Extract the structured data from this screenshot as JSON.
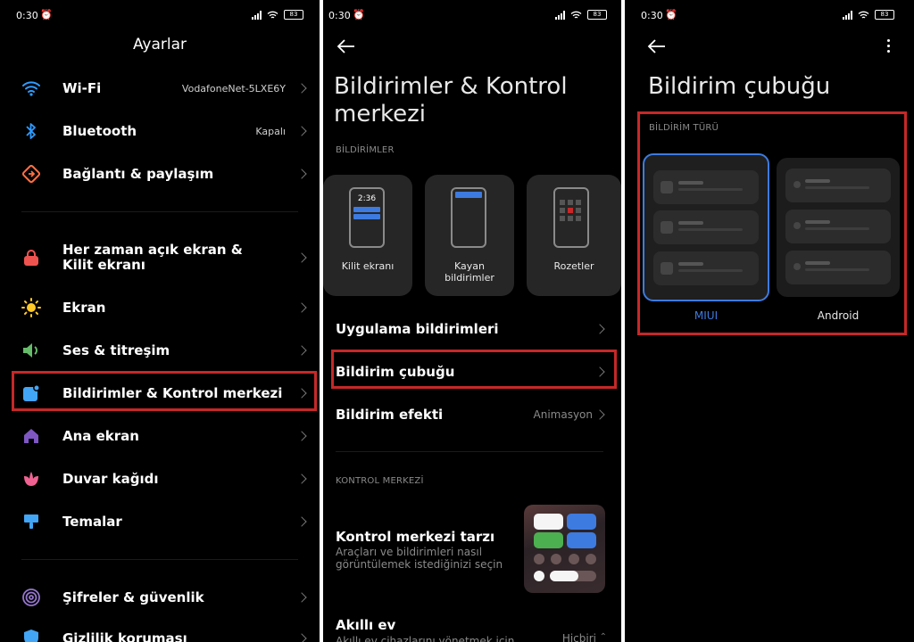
{
  "status": {
    "time": "0:30",
    "battery": "83"
  },
  "panel1": {
    "title": "Ayarlar",
    "items": [
      {
        "label": "Wi-Fi",
        "value": "VodafoneNet-5LXE6Y",
        "icon": "wifi-icon",
        "color": "#2f9bff"
      },
      {
        "label": "Bluetooth",
        "value": "Kapalı",
        "icon": "bluetooth-icon",
        "color": "#2f9bff"
      },
      {
        "label": "Bağlantı & paylaşım",
        "value": "",
        "icon": "connection-share-icon",
        "color": "#ff7043"
      },
      {
        "label": "Her zaman açık ekran & Kilit ekranı",
        "value": "",
        "icon": "lock-icon",
        "color": "#ef5350"
      },
      {
        "label": "Ekran",
        "value": "",
        "icon": "sun-icon",
        "color": "#ffca28"
      },
      {
        "label": "Ses & titreşim",
        "value": "",
        "icon": "speaker-icon",
        "color": "#66bb6a"
      },
      {
        "label": "Bildirimler & Kontrol merkezi",
        "value": "",
        "icon": "notification-icon",
        "color": "#42a5f5"
      },
      {
        "label": "Ana ekran",
        "value": "",
        "icon": "home-icon",
        "color": "#7e57c2"
      },
      {
        "label": "Duvar kağıdı",
        "value": "",
        "icon": "flower-icon",
        "color": "#f06292"
      },
      {
        "label": "Temalar",
        "value": "",
        "icon": "brush-icon",
        "color": "#42a5f5"
      },
      {
        "label": "Şifreler & güvenlik",
        "value": "",
        "icon": "fingerprint-icon",
        "color": "#9575cd"
      },
      {
        "label": "Gizlilik koruması",
        "value": "",
        "icon": "shield-icon",
        "color": "#42a5f5"
      }
    ]
  },
  "panel2": {
    "title_line1": "Bildirimler & Kontrol",
    "title_line2": "merkezi",
    "section_notifications": "BİLDİRİMLER",
    "cards": [
      {
        "label_line1": "Kilit ekranı",
        "label_line2": "",
        "clock": "2:36"
      },
      {
        "label_line1": "Kayan",
        "label_line2": "bildirimler"
      },
      {
        "label_line1": "Rozetler",
        "label_line2": ""
      }
    ],
    "rows": [
      {
        "label": "Uygulama bildirimleri",
        "value": ""
      },
      {
        "label": "Bildirim çubuğu",
        "value": ""
      },
      {
        "label": "Bildirim efekti",
        "value": "Animasyon"
      }
    ],
    "section_control": "KONTROL MERKEZİ",
    "control_style": {
      "title": "Kontrol merkezi tarzı",
      "desc_line1": "Araçları ve bildirimleri nasıl",
      "desc_line2": "görüntülemek istediğinizi seçin"
    },
    "smart_home": {
      "title": "Akıllı ev",
      "desc": "Akıllı ev cihazlarını yönetmek için",
      "value": "Hiçbiri"
    }
  },
  "panel3": {
    "title": "Bildirim çubuğu",
    "section": "BİLDİRİM TÜRÜ",
    "options": [
      {
        "label": "MIUI",
        "selected": true
      },
      {
        "label": "Android",
        "selected": false
      }
    ],
    "accent": "#3d7be0"
  }
}
